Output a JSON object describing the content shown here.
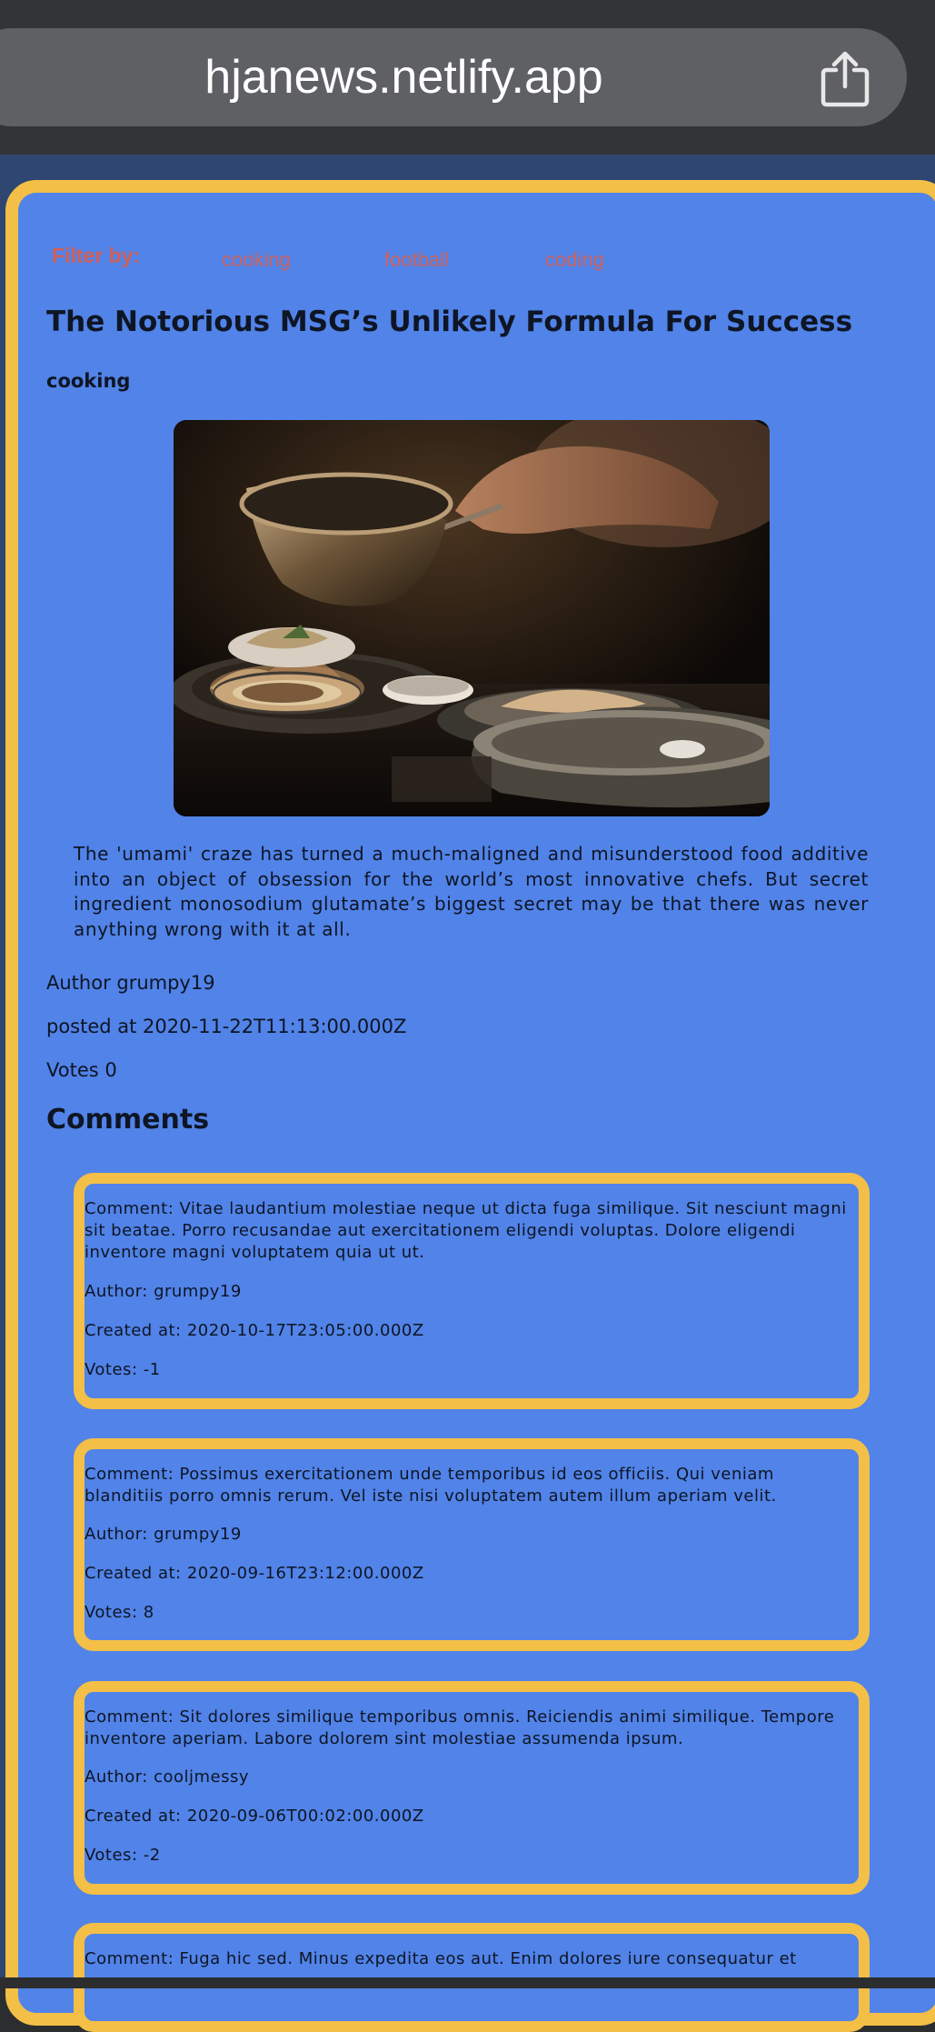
{
  "browser": {
    "url": "hjanews.netlify.app",
    "share_icon": "share-icon"
  },
  "filter": {
    "label": "Filter by:",
    "topics": [
      "cooking",
      "football",
      "coding"
    ]
  },
  "article": {
    "title": "The Notorious MSG’s Unlikely Formula For Success",
    "topic": "cooking",
    "body": "The 'umami' craze has turned a much-maligned and misunderstood food additive into an object of obsession for the world’s most innovative chefs. But secret ingredient monosodium glutamate’s biggest secret may be that there was never anything wrong with it at all.",
    "author": "Author grumpy19",
    "posted_at": "posted at 2020-11-22T11:13:00.000Z",
    "votes": "Votes 0"
  },
  "comments": {
    "heading": "Comments",
    "items": [
      {
        "comment": "Comment: Vitae laudantium molestiae neque ut dicta fuga similique. Sit nesciunt magni sit beatae. Porro recusandae aut exercitationem eligendi voluptas. Dolore eligendi inventore magni voluptatem quia ut ut.",
        "author": "Author: grumpy19",
        "created_at": "Created at: 2020-10-17T23:05:00.000Z",
        "votes": "Votes: -1"
      },
      {
        "comment": "Comment: Possimus exercitationem unde temporibus id eos officiis. Qui veniam blanditiis porro omnis rerum. Vel iste nisi voluptatem autem illum aperiam velit.",
        "author": "Author: grumpy19",
        "created_at": "Created at: 2020-09-16T23:12:00.000Z",
        "votes": "Votes: 8"
      },
      {
        "comment": "Comment: Sit dolores similique temporibus omnis. Reiciendis animi similique. Tempore inventore aperiam. Labore dolorem sint molestiae assumenda ipsum.",
        "author": "Author: cooljmessy",
        "created_at": "Created at: 2020-09-06T00:02:00.000Z",
        "votes": "Votes: -2"
      },
      {
        "comment": "Comment: Fuga hic sed. Minus expedita eos aut. Enim dolores iure consequatur et"
      }
    ]
  },
  "colors": {
    "card_border": "#f3bf47",
    "card_background": "#5183e8",
    "filter_text": "#cc6460"
  }
}
